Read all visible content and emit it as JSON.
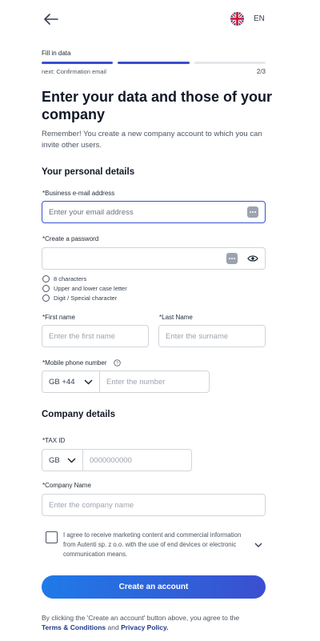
{
  "header": {
    "language": "EN"
  },
  "steps": {
    "current_label": "Fill in data",
    "next_label": "next: Confirmation email",
    "counter": "2/3",
    "filled_segments": 2,
    "total_segments": 3
  },
  "page": {
    "title": "Enter your data and those of your company",
    "subtitle": "Remember! You create a new company account to which you can invite other users."
  },
  "personal": {
    "heading": "Your personal details",
    "email_label": "*Business e-mail address",
    "email_placeholder": "Enter your email address",
    "password_label": "*Create a password",
    "password_rules": [
      "8 characters",
      "Upper and lower case letter",
      "Digit / Special character"
    ],
    "first_name_label": "*First name",
    "first_name_placeholder": "Enter the first name",
    "last_name_label": "*Last Name",
    "last_name_placeholder": "Enter the surname",
    "phone_label": "*Mobile phone number",
    "phone_prefix": "GB +44",
    "phone_placeholder": "Enter the number"
  },
  "company": {
    "heading": "Company details",
    "tax_label": "*TAX ID",
    "tax_country": "GB",
    "tax_placeholder": "0000000000",
    "name_label": "*Company Name",
    "name_placeholder": "Enter the company name"
  },
  "consent": {
    "text": "I agree to receive marketing content and commercial information from Autenti sp. z o.o. with the use of end devices or electronic communication means."
  },
  "submit_label": "Create an account",
  "footer": {
    "text": "By clicking the 'Create an account' button above, you agree to the",
    "terms_link": "Terms & Conditions",
    "and": "and",
    "privacy_link": "Privacy Policy."
  },
  "colors": {
    "accent": "#3b4fd0",
    "button_start": "#1f7ae8",
    "button_end": "#3b4fd0"
  },
  "icons": [
    "back-arrow-icon",
    "uk-flag-icon",
    "password-manager-icon",
    "eye-icon",
    "info-icon",
    "chevron-down-icon"
  ]
}
